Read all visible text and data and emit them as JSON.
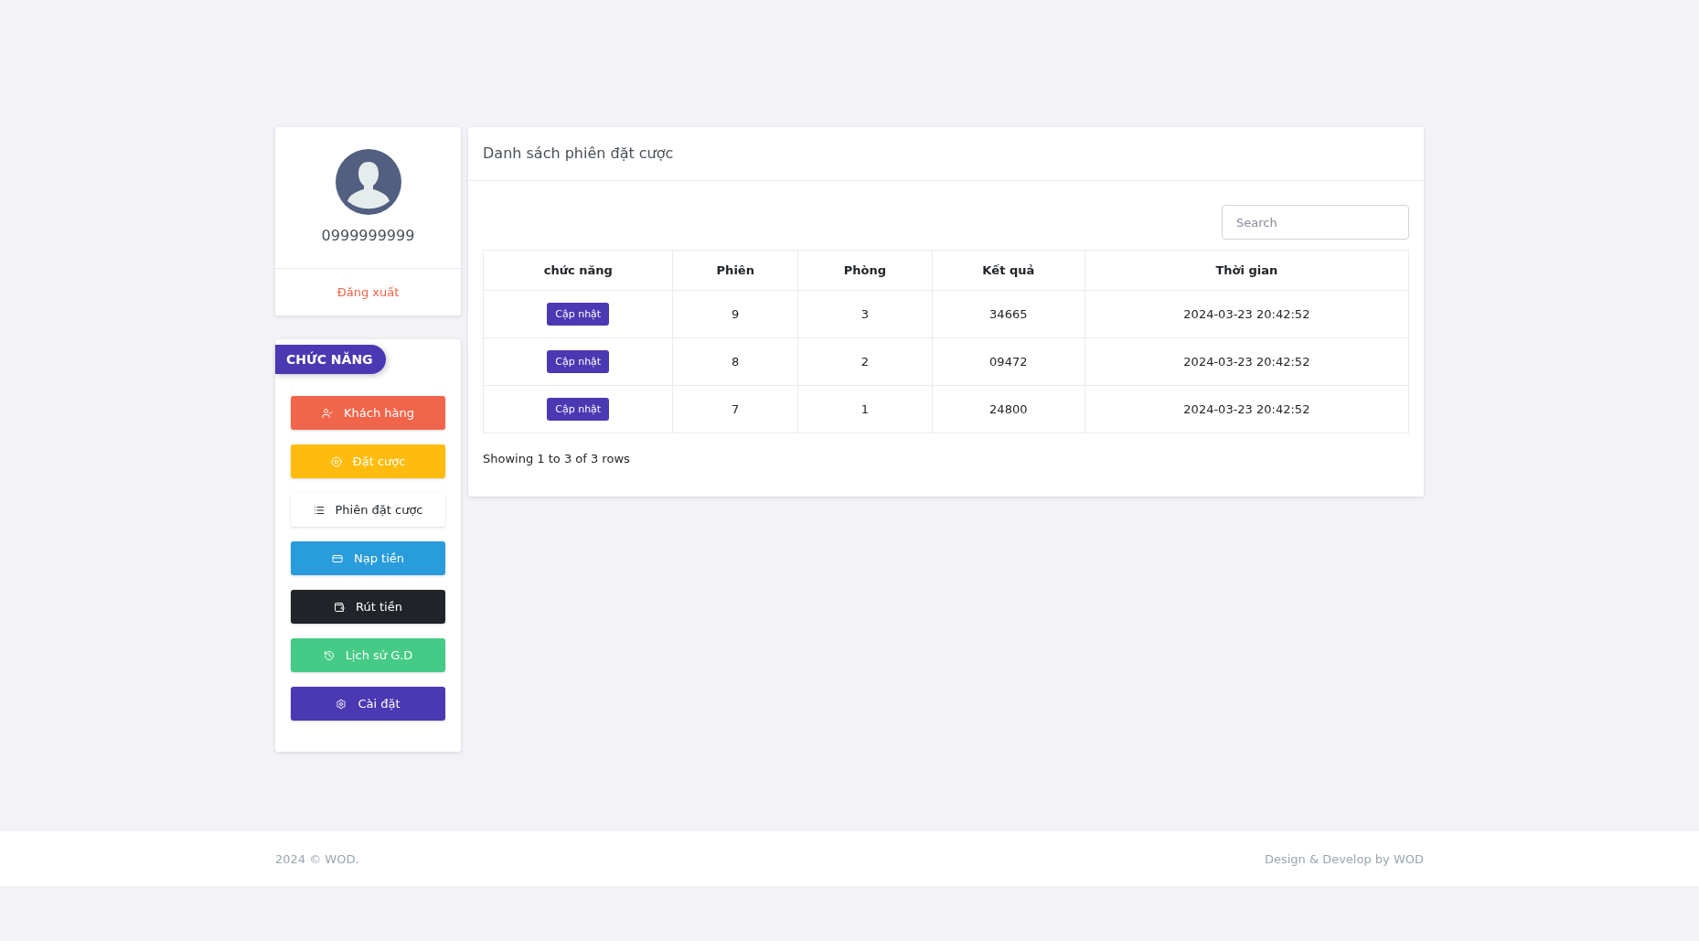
{
  "profile": {
    "phone": "0999999999",
    "logout": "Đăng xuất"
  },
  "menu": {
    "title": "CHỨC NĂNG",
    "items": [
      {
        "label": "Khách hàng",
        "kind": "customers",
        "color": "#f1664a"
      },
      {
        "label": "Đặt cược",
        "kind": "betting",
        "color": "#ffbc0d"
      },
      {
        "label": "Phiên đặt cược",
        "kind": "sessions",
        "color": "#ffffff"
      },
      {
        "label": "Nạp tiền",
        "kind": "deposit",
        "color": "#299cdb"
      },
      {
        "label": "Rút tiền",
        "kind": "withdraw",
        "color": "#212529"
      },
      {
        "label": "Lịch sử G.D",
        "kind": "history",
        "color": "#45cb85"
      },
      {
        "label": "Cài đặt",
        "kind": "settings",
        "color": "#4b38b3"
      }
    ]
  },
  "panel": {
    "title": "Danh sách phiên đặt cược",
    "search": {
      "placeholder": "Search"
    },
    "table": {
      "columns": [
        "chức năng",
        "Phiên",
        "Phòng",
        "Kết quả",
        "Thời gian"
      ],
      "rows": [
        {
          "action": "Cập nhật",
          "session": "9",
          "room": "3",
          "result": "34665",
          "time": "2024-03-23 20:42:52"
        },
        {
          "action": "Cập nhật",
          "session": "8",
          "room": "2",
          "result": "09472",
          "time": "2024-03-23 20:42:52"
        },
        {
          "action": "Cập nhật",
          "session": "7",
          "room": "1",
          "result": "24800",
          "time": "2024-03-23 20:42:52"
        }
      ]
    },
    "pagination_info": "Showing 1 to 3 of 3 rows"
  },
  "footer": {
    "left": "2024 © WOD.",
    "right": "Design & Develop by WOD"
  }
}
